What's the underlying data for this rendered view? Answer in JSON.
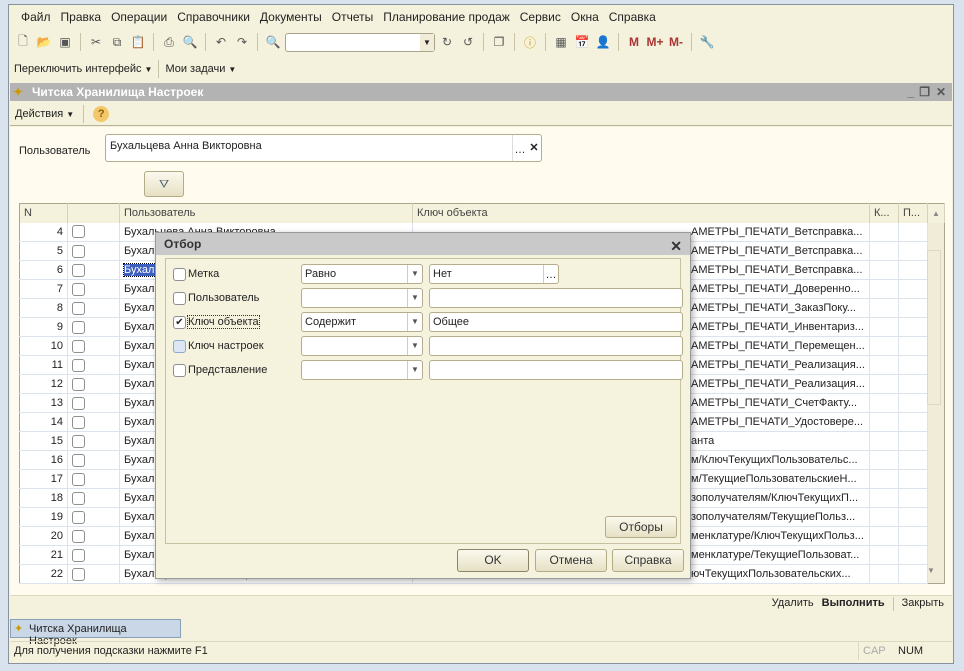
{
  "menu": [
    "Файл",
    "Правка",
    "Операции",
    "Справочники",
    "Документы",
    "Отчеты",
    "Планирование продаж",
    "Сервис",
    "Окна",
    "Справка"
  ],
  "toolbar2": {
    "switch_interface": "Переключить интерфейс",
    "my_tasks": "Мои задачи"
  },
  "memory_buttons": [
    "M",
    "M+",
    "M-"
  ],
  "child_window": {
    "title": "Читска Хранилища Настроек",
    "actions": "Действия"
  },
  "form": {
    "user_label": "Пользователь",
    "user_value": "Бухальцева Анна Викторовна"
  },
  "table": {
    "columns": [
      "N",
      "",
      "Пользователь",
      "Ключ объекта",
      "К...",
      "П..."
    ],
    "rows": [
      {
        "n": "4",
        "user": "Бухальцева Анна Викторовна",
        "key": "АМЕТРЫ_ПЕЧАТИ_Ветсправка..."
      },
      {
        "n": "5",
        "user": "Бухальцева Анна Викторовна",
        "key": "АМЕТРЫ_ПЕЧАТИ_Ветсправка..."
      },
      {
        "n": "6",
        "user": "Бухальцева Анна Викторовна",
        "key": "АМЕТРЫ_ПЕЧАТИ_Ветсправка...",
        "selected": true
      },
      {
        "n": "7",
        "user": "Бухальцева Анна Викторовна",
        "key": "АМЕТРЫ_ПЕЧАТИ_Доверенно..."
      },
      {
        "n": "8",
        "user": "Бухальцева Анна Викторовна",
        "key": "АМЕТРЫ_ПЕЧАТИ_ЗаказПоку..."
      },
      {
        "n": "9",
        "user": "Бухальцева Анна Викторовна",
        "key": "АМЕТРЫ_ПЕЧАТИ_Инвентариз..."
      },
      {
        "n": "10",
        "user": "Бухальцева Анна Викторовна",
        "key": "АМЕТРЫ_ПЕЧАТИ_Перемещен..."
      },
      {
        "n": "11",
        "user": "Бухальцева Анна Викторовна",
        "key": "АМЕТРЫ_ПЕЧАТИ_Реализация..."
      },
      {
        "n": "12",
        "user": "Бухальцева Анна Викторовна",
        "key": "АМЕТРЫ_ПЕЧАТИ_Реализация..."
      },
      {
        "n": "13",
        "user": "Бухальцева Анна Викторовна",
        "key": "АМЕТРЫ_ПЕЧАТИ_СчетФакту..."
      },
      {
        "n": "14",
        "user": "Бухальцева Анна Викторовна",
        "key": "АМЕТРЫ_ПЕЧАТИ_Удостовере..."
      },
      {
        "n": "15",
        "user": "Бухальцева Анна Викторовна",
        "key": "анта"
      },
      {
        "n": "16",
        "user": "Бухальцева Анна Викторовна",
        "key": "м/КлючТекущихПользовательс..."
      },
      {
        "n": "17",
        "user": "Бухальцева Анна Викторовна",
        "key": "м/ТекущиеПользовательскиеН..."
      },
      {
        "n": "18",
        "user": "Бухальцева Анна Викторовна",
        "key": "зополучателям/КлючТекущихП..."
      },
      {
        "n": "19",
        "user": "Бухальцева Анна Викторовна",
        "key": "зополучателям/ТекущиеПольз..."
      },
      {
        "n": "20",
        "user": "Бухальцева Анна Викторовна",
        "key": "менклатуре/КлючТекущихПольз..."
      },
      {
        "n": "21",
        "user": "Бухальцева Анна Викторовна",
        "key": "менклатуре/ТекущиеПользоват..."
      },
      {
        "n": "22",
        "user": "Бухальцева Анна Викторовна",
        "key": "ючТекущихПользовательских..."
      }
    ]
  },
  "dialog": {
    "title": "Отбор",
    "rows": [
      {
        "label": "Метка",
        "checked": false,
        "condition": "Равно",
        "value": "Нет"
      },
      {
        "label": "Пользователь",
        "checked": false,
        "condition": "",
        "value": ""
      },
      {
        "label": "Ключ объекта",
        "checked": true,
        "condition": "Содержит",
        "value": "Общее"
      },
      {
        "label": "Ключ настроек",
        "checked": false,
        "condition": "",
        "value": ""
      },
      {
        "label": "Представление",
        "checked": false,
        "condition": "",
        "value": ""
      }
    ],
    "filters_button": "Отборы",
    "ok": "OK",
    "cancel": "Отмена",
    "help": "Справка"
  },
  "bottom": {
    "delete": "Удалить",
    "execute": "Выполнить",
    "close": "Закрыть"
  },
  "taskbar": {
    "tab": "Читска Хранилища Настроек"
  },
  "status": {
    "hint": "Для получения подсказки нажмите F1",
    "cap": "CAP",
    "num": "NUM"
  },
  "colors": {
    "app_bg": "#f4f1dc",
    "form_bg": "#fffbef",
    "title_gray": "#b3b3b3",
    "selection": "#3d5fbf"
  }
}
